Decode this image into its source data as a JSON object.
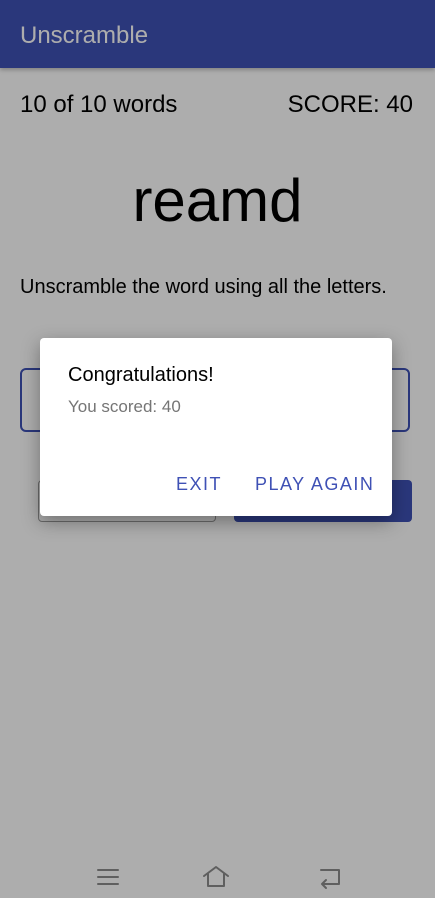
{
  "app": {
    "title": "Unscramble"
  },
  "game": {
    "word_count": "10 of 10 words",
    "score": "SCORE: 40",
    "scrambled_word": "reamd",
    "instructions": "Unscramble the word using all the letters.",
    "input_value": ""
  },
  "dialog": {
    "title": "Congratulations!",
    "message": "You scored: 40",
    "exit_label": "EXIT",
    "play_again_label": "PLAY AGAIN"
  },
  "nav": {
    "icons": [
      "menu-icon",
      "home-icon",
      "back-icon"
    ]
  },
  "colors": {
    "primary": "#3f51b5",
    "scrim": "rgba(0,0,0,0.32)",
    "dialog_message": "#757575"
  }
}
